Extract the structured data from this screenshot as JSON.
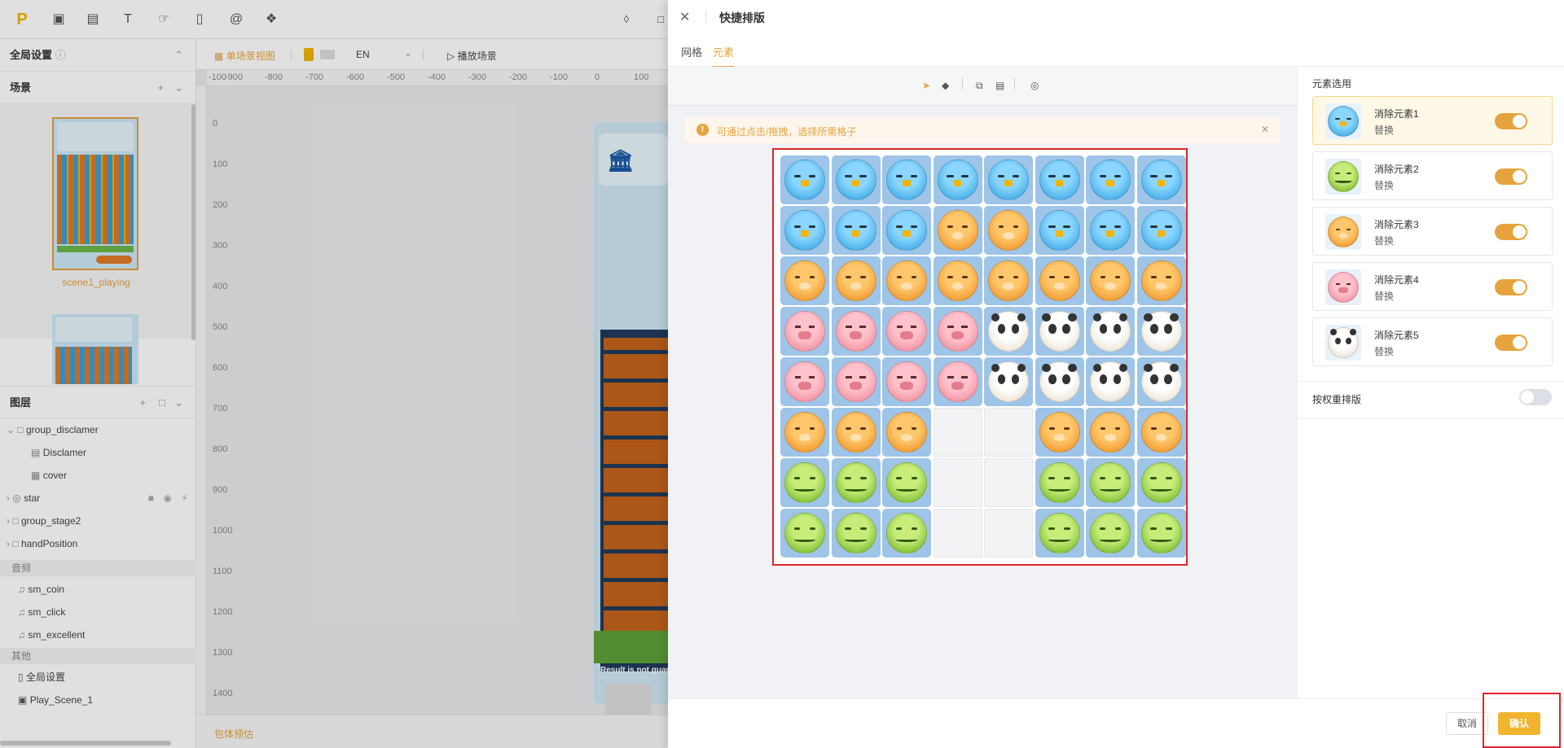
{
  "app": {
    "logo": "P",
    "left": {
      "global_settings": "全局设置",
      "scenes_title": "场景",
      "scene1_name": "scene1_playing",
      "layers_title": "图层",
      "layers": [
        {
          "label": "group_disclamer"
        },
        {
          "label": "Disclamer"
        },
        {
          "label": "cover"
        },
        {
          "label": "star"
        },
        {
          "label": "group_stage2"
        },
        {
          "label": "handPosition"
        }
      ],
      "audio_title": "音频",
      "audio": [
        "sm_coin",
        "sm_click",
        "sm_excellent"
      ],
      "other_title": "其他",
      "other": [
        "全局设置",
        "Play_Scene_1"
      ]
    },
    "canvas": {
      "view_label": "单场景视图",
      "lang": "EN",
      "play_label": "播放场景",
      "ruler_x": [
        "-100",
        "-900",
        "-800",
        "-700",
        "-600",
        "-500",
        "-400",
        "-300",
        "-200",
        "-100",
        "0",
        "100"
      ],
      "ruler_y": [
        "0",
        "100",
        "200",
        "300",
        "400",
        "500",
        "600",
        "700",
        "800",
        "900",
        "1000",
        "1100",
        "1200",
        "1300",
        "1400"
      ],
      "preview_text": "Result is not guar",
      "bottom_label": "包体预估"
    }
  },
  "drawer": {
    "title": "快捷排版",
    "tabs": [
      "网格",
      "元素"
    ],
    "active_tab": "元素",
    "hint": "可通过点击/拖拽，选择所需格子",
    "grid": [
      [
        "bird",
        "bird",
        "bird",
        "bird",
        "bird",
        "bird",
        "bird",
        "bird"
      ],
      [
        "bird",
        "bird",
        "bird",
        "cat",
        "cat",
        "bird",
        "bird",
        "bird"
      ],
      [
        "cat",
        "cat",
        "cat",
        "cat",
        "cat",
        "cat",
        "cat",
        "cat"
      ],
      [
        "pig",
        "pig",
        "pig",
        "pig",
        "panda",
        "panda",
        "panda",
        "panda"
      ],
      [
        "pig",
        "pig",
        "pig",
        "pig",
        "panda",
        "panda",
        "panda",
        "panda"
      ],
      [
        "cat",
        "cat",
        "cat",
        "",
        "",
        "cat",
        "cat",
        "cat"
      ],
      [
        "frog",
        "frog",
        "frog",
        "",
        "",
        "frog",
        "frog",
        "frog"
      ],
      [
        "frog",
        "frog",
        "frog",
        "",
        "",
        "frog",
        "frog",
        "frog"
      ]
    ],
    "element_select_title": "元素选用",
    "elements": [
      {
        "name": "消除元素1",
        "action": "替换",
        "kind": "bird",
        "enabled": true
      },
      {
        "name": "消除元素2",
        "action": "替换",
        "kind": "frog",
        "enabled": true
      },
      {
        "name": "消除元素3",
        "action": "替换",
        "kind": "cat",
        "enabled": true
      },
      {
        "name": "消除元素4",
        "action": "替换",
        "kind": "pig",
        "enabled": true
      },
      {
        "name": "消除元素5",
        "action": "替换",
        "kind": "panda",
        "enabled": true
      }
    ],
    "weight_label": "按权重排版",
    "weight_enabled": false,
    "cancel": "取消",
    "confirm": "确认"
  },
  "colors": {
    "accent": "#e6a23c",
    "highlight_border": "#e0252b",
    "bird": "#4fb3ea",
    "cat": "#f2a13a",
    "pig": "#f29aa8",
    "panda": "#efe8dc",
    "frog": "#8cc63f"
  }
}
